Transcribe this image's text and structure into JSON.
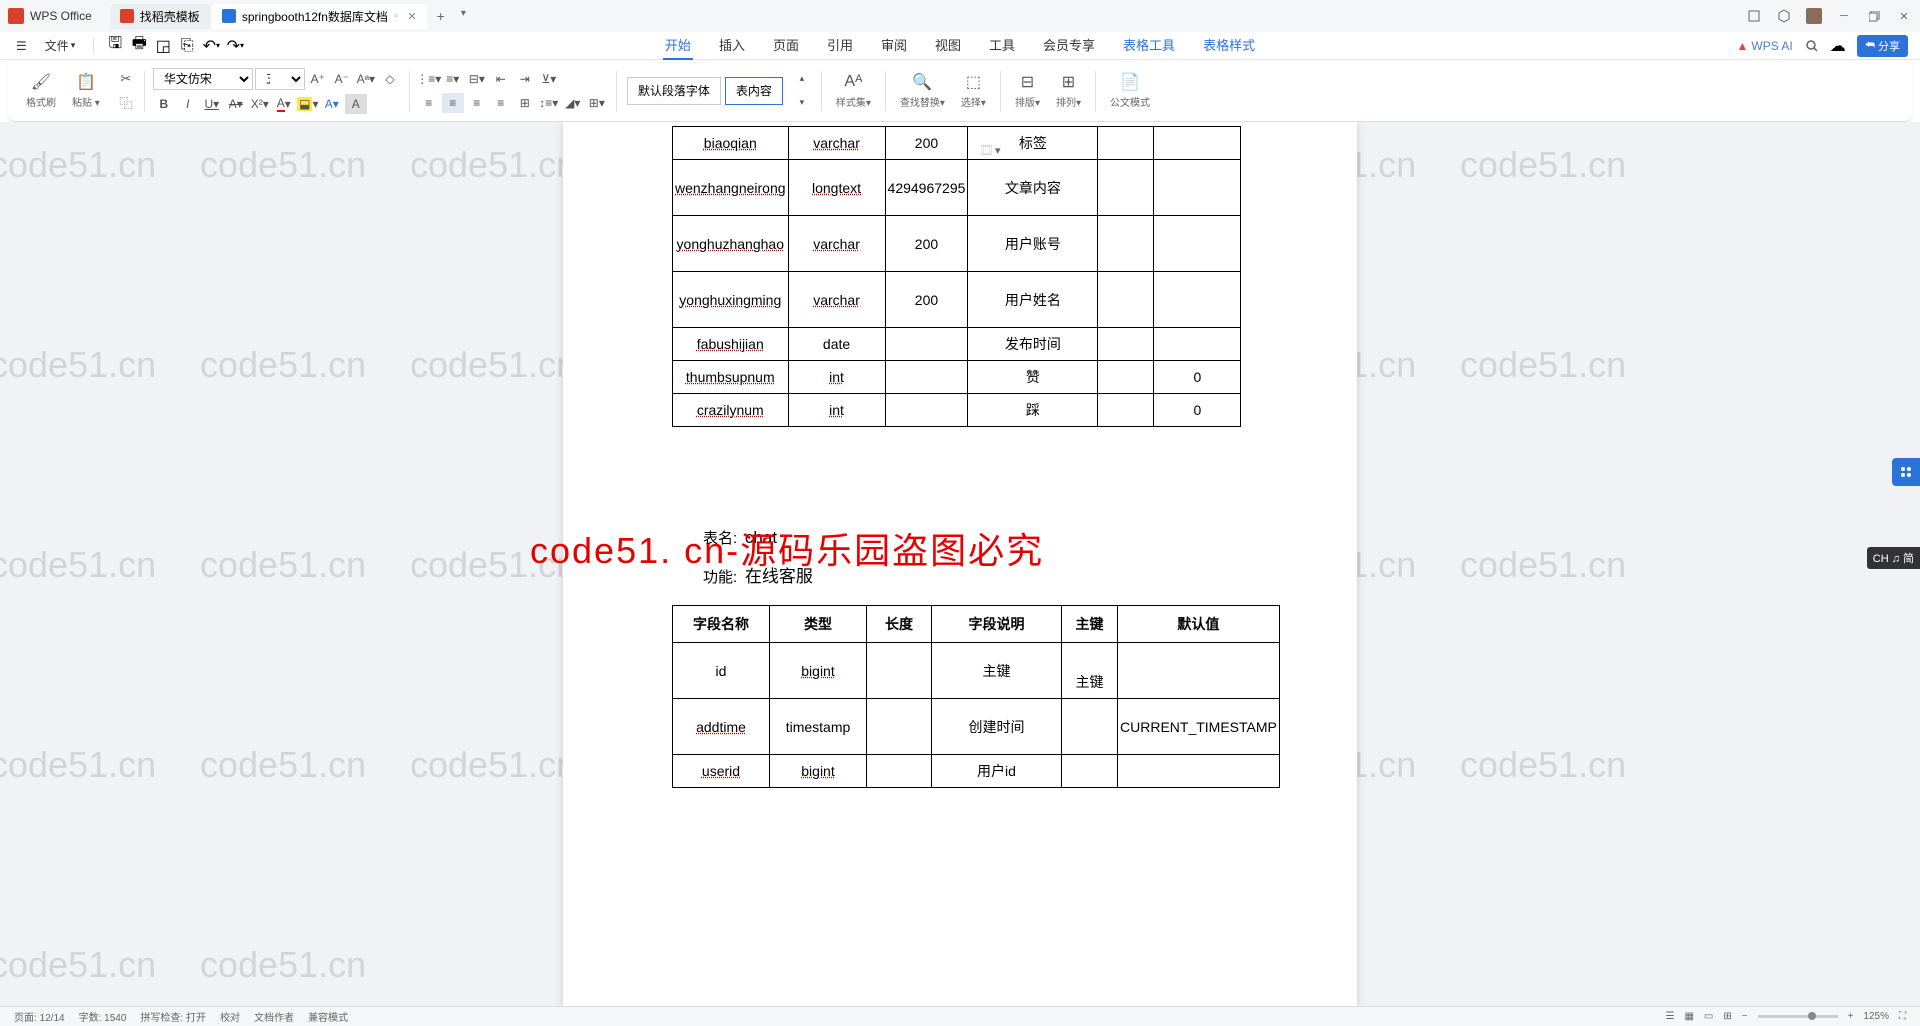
{
  "app": {
    "name": "WPS Office"
  },
  "tabs": [
    {
      "label": "找稻壳模板"
    },
    {
      "label": "springbooth12fn数据库文档"
    }
  ],
  "file_menu": "文件",
  "menu": {
    "items": [
      "开始",
      "插入",
      "页面",
      "引用",
      "审阅",
      "视图",
      "工具",
      "会员专享"
    ],
    "special": [
      "表格工具",
      "表格样式"
    ],
    "ai": "WPS AI",
    "share": "分享"
  },
  "ribbon": {
    "format_painter": "格式刷",
    "paste": "粘贴",
    "font_name": "华文仿宋",
    "font_size": "五号",
    "style_default": "默认段落字体",
    "style_content": "表内容",
    "style_set": "样式集",
    "find_replace": "查找替换",
    "select": "选择",
    "arrange_v": "排版",
    "arrange_h": "排列",
    "gov_mode": "公文模式"
  },
  "document": {
    "table1_rows": [
      {
        "c1": "biaoqian",
        "c2": "varchar",
        "c3": "200",
        "c4": "标签",
        "c5": "",
        "c6": ""
      },
      {
        "c1": "wenzhangneirong",
        "c2": "longtext",
        "c3": "4294967295",
        "c4": "文章内容",
        "c5": "",
        "c6": ""
      },
      {
        "c1": "yonghuzhanghao",
        "c2": "varchar",
        "c3": "200",
        "c4": "用户账号",
        "c5": "",
        "c6": ""
      },
      {
        "c1": "yonghuxingming",
        "c2": "varchar",
        "c3": "200",
        "c4": "用户姓名",
        "c5": "",
        "c6": ""
      },
      {
        "c1": "fabushijian",
        "c2": "date",
        "c3": "",
        "c4": "发布时间",
        "c5": "",
        "c6": ""
      },
      {
        "c1": "thumbsupnum",
        "c2": "int",
        "c3": "",
        "c4": "赞",
        "c5": "",
        "c6": "0"
      },
      {
        "c1": "crazilynum",
        "c2": "int",
        "c3": "",
        "c4": "踩",
        "c5": "",
        "c6": "0"
      }
    ],
    "table_name_label": "表名:",
    "table_name_value": "chat",
    "func_label": "功能:",
    "func_value": "在线客服",
    "table2_headers": [
      "字段名称",
      "类型",
      "长度",
      "字段说明",
      "主键",
      "默认值"
    ],
    "table2_rows": [
      {
        "c1": "id",
        "c2": "bigint",
        "c3": "",
        "c4": "主键",
        "c5": "主键",
        "c6": ""
      },
      {
        "c1": "addtime",
        "c2": "timestamp",
        "c3": "",
        "c4": "创建时间",
        "c5": "",
        "c6": "CURRENT_TIMESTAMP"
      },
      {
        "c1": "userid",
        "c2": "bigint",
        "c3": "",
        "c4": "用户id",
        "c5": "",
        "c6": ""
      }
    ]
  },
  "overlay_text": "code51. cn-源码乐园盗图必究",
  "watermark_text": "code51.cn",
  "ime_badge": "CH ♫ 简",
  "status": {
    "page": "页面: 12/14",
    "words": "字数: 1540",
    "spell": "拼写检查: 打开",
    "proof": "校对",
    "author": "文档作者",
    "mode": "兼容模式",
    "zoom": "125%"
  }
}
